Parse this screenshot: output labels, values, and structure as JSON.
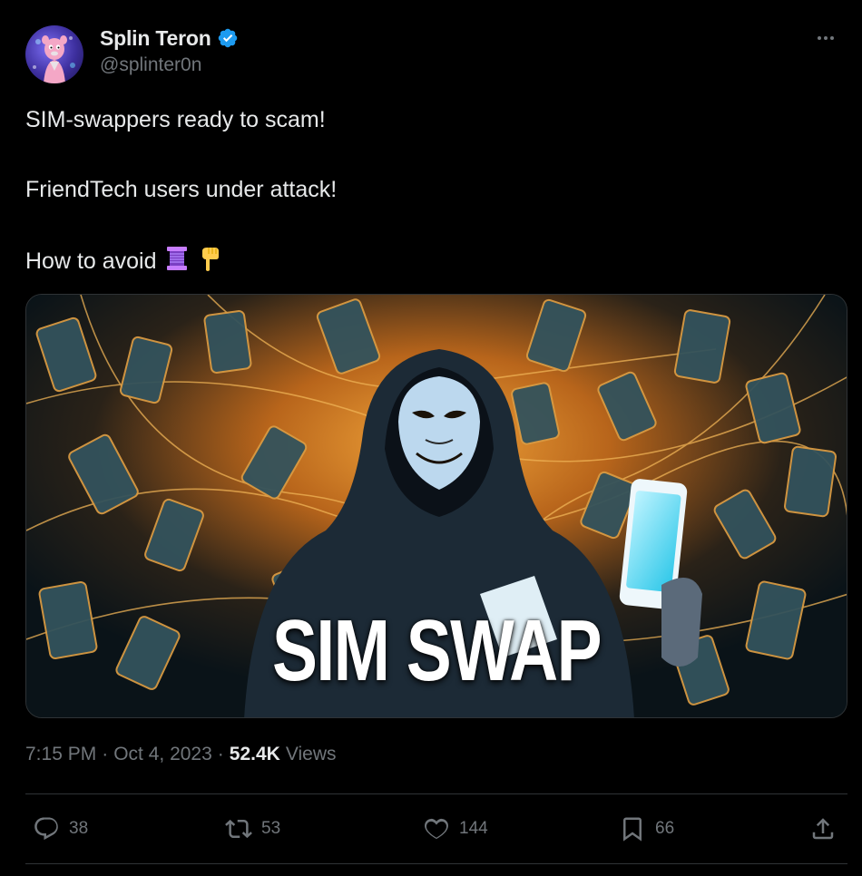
{
  "author": {
    "display_name": "Splin Teron",
    "handle": "@splinter0n",
    "verified": true,
    "avatar_icon": "pink-panther-avatar",
    "verified_color": "#1d9bf0"
  },
  "tweet": {
    "lines": [
      "SIM-swappers ready to scam!",
      "FriendTech users under attack!",
      "How to avoid"
    ],
    "emojis": [
      "thread-icon",
      "pointing-down-icon"
    ]
  },
  "media": {
    "caption": "SIM SWAP",
    "subject": "hooded-masked-hacker-with-phones-image"
  },
  "meta": {
    "time": "7:15 PM",
    "date": "Oct 4, 2023",
    "separator": "·",
    "views_count": "52.4K",
    "views_label": "Views"
  },
  "actions": {
    "replies": "38",
    "reposts": "53",
    "likes": "144",
    "bookmarks": "66"
  },
  "colors": {
    "background": "#000000",
    "text_primary": "#e7e9ea",
    "text_secondary": "#71767b",
    "border": "#2f3336",
    "accent": "#1d9bf0"
  }
}
